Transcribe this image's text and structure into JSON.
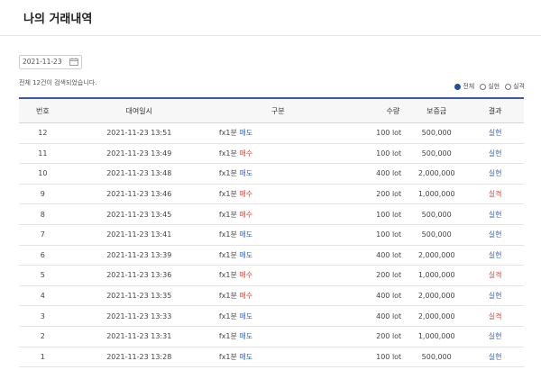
{
  "page": {
    "title": "나의 거래내역",
    "date_value": "2021-11-23",
    "count_text": "전체 12건이 검색되었습니다."
  },
  "filters": [
    {
      "label": "전체",
      "checked": true
    },
    {
      "label": "실현",
      "checked": false
    },
    {
      "label": "실격",
      "checked": false
    }
  ],
  "table": {
    "headers": {
      "no": "번호",
      "datetime": "대여일시",
      "type": "구분",
      "qty": "수량",
      "margin": "보증금",
      "result": "결과"
    },
    "rows": [
      {
        "no": "12",
        "datetime": "2021-11-23 13:51",
        "product": "fx1분",
        "side": "매도",
        "qty": "100 lot",
        "margin": "500,000",
        "result": "실현"
      },
      {
        "no": "11",
        "datetime": "2021-11-23 13:49",
        "product": "fx1분",
        "side": "매수",
        "qty": "100 lot",
        "margin": "500,000",
        "result": "실현"
      },
      {
        "no": "10",
        "datetime": "2021-11-23 13:48",
        "product": "fx1분",
        "side": "매도",
        "qty": "400 lot",
        "margin": "2,000,000",
        "result": "실현"
      },
      {
        "no": "9",
        "datetime": "2021-11-23 13:46",
        "product": "fx1분",
        "side": "매수",
        "qty": "200 lot",
        "margin": "1,000,000",
        "result": "실격"
      },
      {
        "no": "8",
        "datetime": "2021-11-23 13:45",
        "product": "fx1분",
        "side": "매수",
        "qty": "100 lot",
        "margin": "500,000",
        "result": "실현"
      },
      {
        "no": "7",
        "datetime": "2021-11-23 13:41",
        "product": "fx1분",
        "side": "매도",
        "qty": "100 lot",
        "margin": "500,000",
        "result": "실현"
      },
      {
        "no": "6",
        "datetime": "2021-11-23 13:39",
        "product": "fx1분",
        "side": "매도",
        "qty": "400 lot",
        "margin": "2,000,000",
        "result": "실현"
      },
      {
        "no": "5",
        "datetime": "2021-11-23 13:36",
        "product": "fx1분",
        "side": "매수",
        "qty": "200 lot",
        "margin": "1,000,000",
        "result": "실격"
      },
      {
        "no": "4",
        "datetime": "2021-11-23 13:35",
        "product": "fx1분",
        "side": "매수",
        "qty": "400 lot",
        "margin": "2,000,000",
        "result": "실현"
      },
      {
        "no": "3",
        "datetime": "2021-11-23 13:33",
        "product": "fx1분",
        "side": "매도",
        "qty": "400 lot",
        "margin": "2,000,000",
        "result": "실격"
      },
      {
        "no": "2",
        "datetime": "2021-11-23 13:31",
        "product": "fx1분",
        "side": "매도",
        "qty": "200 lot",
        "margin": "1,000,000",
        "result": "실현"
      },
      {
        "no": "1",
        "datetime": "2021-11-23 13:28",
        "product": "fx1분",
        "side": "매도",
        "qty": "100 lot",
        "margin": "500,000",
        "result": "실현"
      }
    ]
  },
  "colors": {
    "sell": "#3a66b8",
    "buy": "#d04a3a",
    "win": "#3a66b8",
    "lose": "#d04a3a",
    "accent": "#1f4ea6"
  },
  "icons": {
    "date": "calendar-icon"
  }
}
